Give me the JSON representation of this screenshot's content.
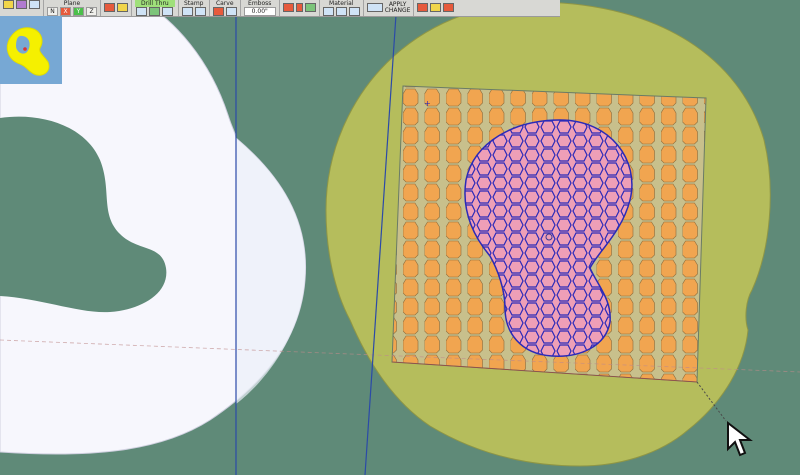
{
  "toolbar": {
    "plane": {
      "title": "Plane",
      "axes": [
        "N",
        "X",
        "Y",
        "Z"
      ]
    },
    "drill_thru": {
      "title": "Drill Thru"
    },
    "stamp": {
      "title": "Stamp"
    },
    "carve": {
      "title": "Carve"
    },
    "emboss": {
      "title": "Emboss",
      "value": "0.00\""
    },
    "material": {
      "title": "Material"
    },
    "apply_change": {
      "line1": "APPLY",
      "line2": "CHANGE"
    }
  },
  "icons": [
    "open-icon",
    "select-arrow-icon",
    "play-icon",
    "emboss-icon",
    "material-swatch-icon",
    "apply-icon",
    "close-icon",
    "cancel-icon",
    "exit-icon",
    "cursor-icon"
  ],
  "colors": {
    "terrain_green": "#5f8a78",
    "olive_disc": "#b5bd5c",
    "white_surface": "#f7f7fd",
    "orange_cell": "#f1a550",
    "pink_shape": "#ee9fb7",
    "blue_outline": "#2b2ab8",
    "thumbnail_bg": "#77a8d4",
    "thumbnail_shape": "#f5f000"
  }
}
